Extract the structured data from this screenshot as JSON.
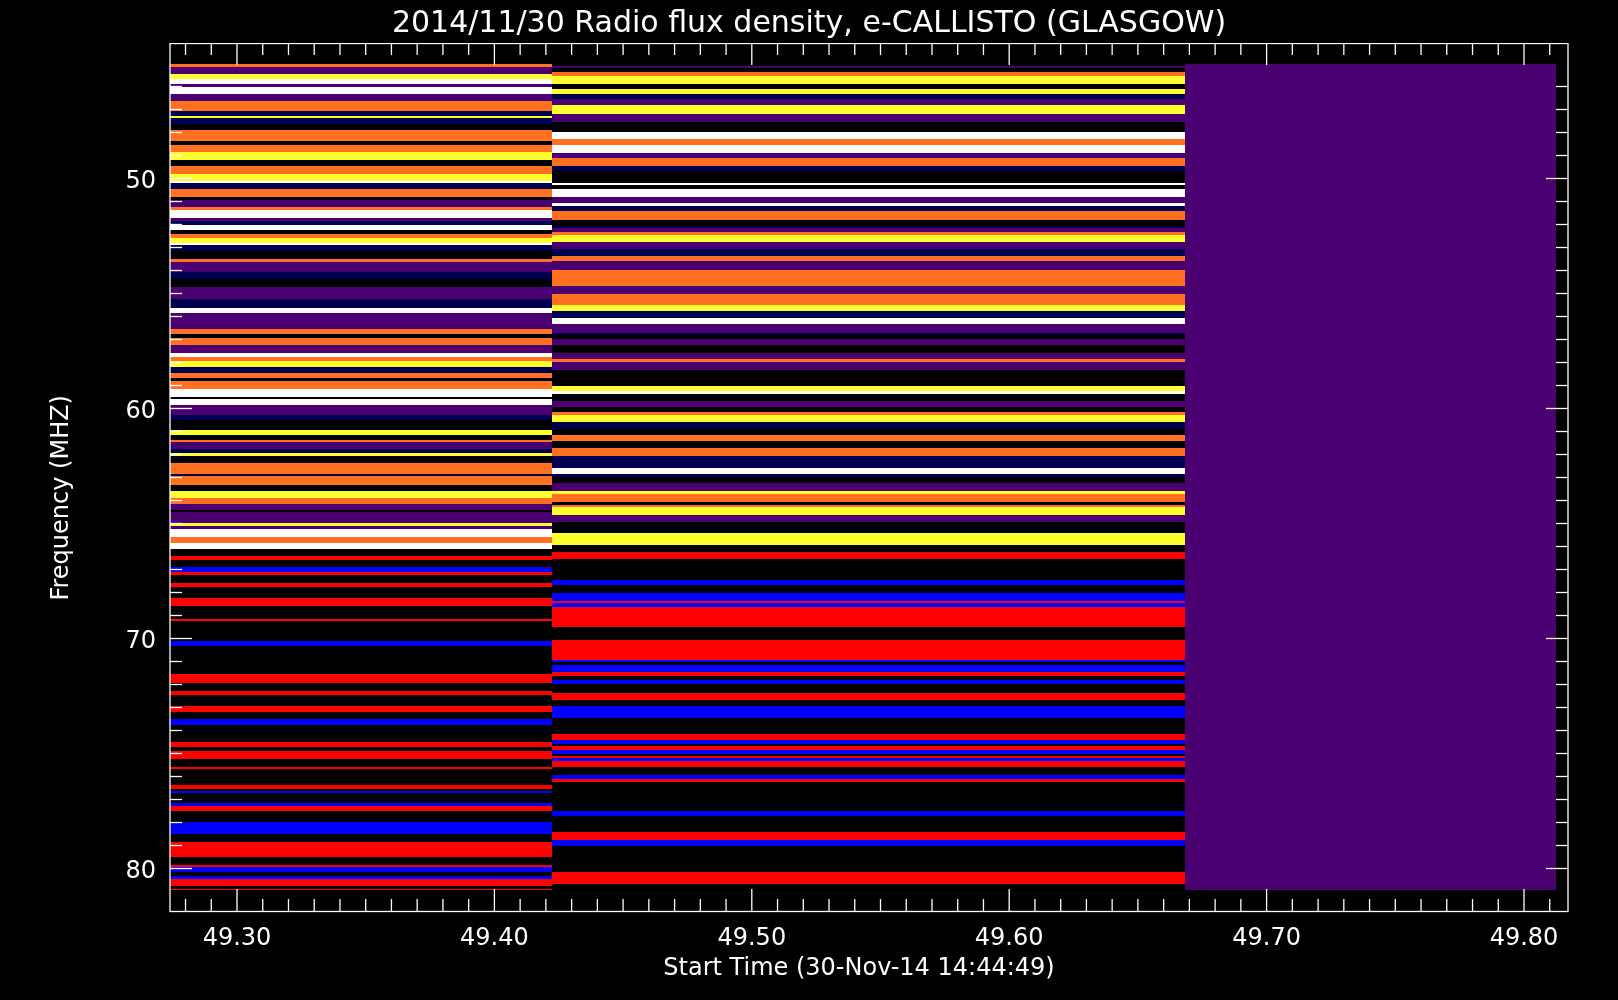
{
  "title": "2014/11/30  Radio flux density, e-CALLISTO (GLASGOW)",
  "y_axis": {
    "label": "Frequency (MHZ)",
    "ticks": [
      "50",
      "60",
      "70",
      "80"
    ]
  },
  "x_axis": {
    "label": "Start Time (30-Nov-14 14:44:49)",
    "ticks": [
      "49.30",
      "49.40",
      "49.50",
      "49.60",
      "49.70",
      "49.80"
    ]
  }
}
